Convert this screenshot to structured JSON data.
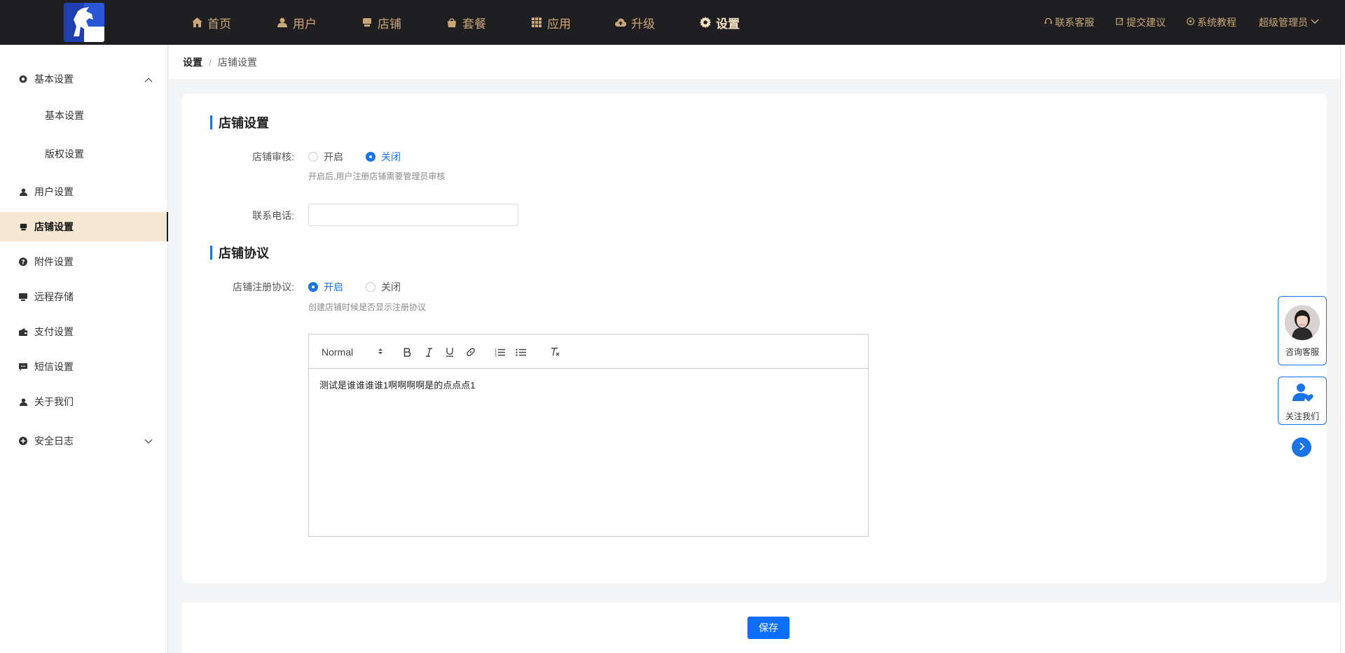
{
  "topnav": {
    "items": [
      {
        "label": "首页",
        "icon": "home-icon"
      },
      {
        "label": "用户",
        "icon": "user-icon"
      },
      {
        "label": "店铺",
        "icon": "store-icon"
      },
      {
        "label": "套餐",
        "icon": "package-icon"
      },
      {
        "label": "应用",
        "icon": "apps-icon"
      },
      {
        "label": "升级",
        "icon": "cloud-upload-icon"
      },
      {
        "label": "设置",
        "icon": "gear-icon",
        "active": true
      }
    ],
    "right": {
      "support": "联系客服",
      "suggest": "提交建议",
      "tutorial": "系统教程",
      "admin": "超级管理员"
    },
    "accent_color": "#c9a77a"
  },
  "sidebar": {
    "items": [
      {
        "label": "基本设置",
        "icon": "gear-icon",
        "expanded": true
      },
      {
        "label": "基本设置",
        "sub": true
      },
      {
        "label": "版权设置",
        "sub": true
      },
      {
        "label": "用户设置",
        "icon": "user-icon"
      },
      {
        "label": "店铺设置",
        "icon": "store-icon",
        "active": true
      },
      {
        "label": "附件设置",
        "icon": "question-circle-icon"
      },
      {
        "label": "远程存储",
        "icon": "monitor-icon"
      },
      {
        "label": "支付设置",
        "icon": "wallet-icon"
      },
      {
        "label": "短信设置",
        "icon": "message-icon"
      },
      {
        "label": "关于我们",
        "icon": "user-icon"
      },
      {
        "label": "安全日志",
        "icon": "plus-circle-icon",
        "collapsed": true
      }
    ]
  },
  "breadcrumb": {
    "root": "设置",
    "separator": "/",
    "current": "店铺设置"
  },
  "form": {
    "section1_title": "店铺设置",
    "audit": {
      "label": "店铺审核:",
      "on_label": "开启",
      "off_label": "关闭",
      "selected": "关闭",
      "hint": "开启后,用户注册店铺需要管理员审核"
    },
    "phone": {
      "label": "联系电话:",
      "value": "",
      "placeholder": ""
    },
    "section2_title": "店铺协议",
    "agreement": {
      "label": "店铺注册协议:",
      "on_label": "开启",
      "off_label": "关闭",
      "selected": "开启",
      "hint": "创建店铺时候是否显示注册协议"
    },
    "editor": {
      "format_select": "Normal",
      "tools": [
        "bold-icon",
        "italic-icon",
        "underline-icon",
        "link-icon",
        "ordered-list-icon",
        "bullet-list-icon",
        "clear-format-icon"
      ],
      "content": "测试是谁谁谁谁1啊啊啊啊是的点点点1"
    },
    "save_label": "保存"
  },
  "floating": {
    "consult_label": "咨询客服",
    "follow_label": "关注我们"
  },
  "colors": {
    "primary": "#1a73e8",
    "topbar_bg": "#1f1f22",
    "active_side_bg": "#f6e7d2"
  }
}
